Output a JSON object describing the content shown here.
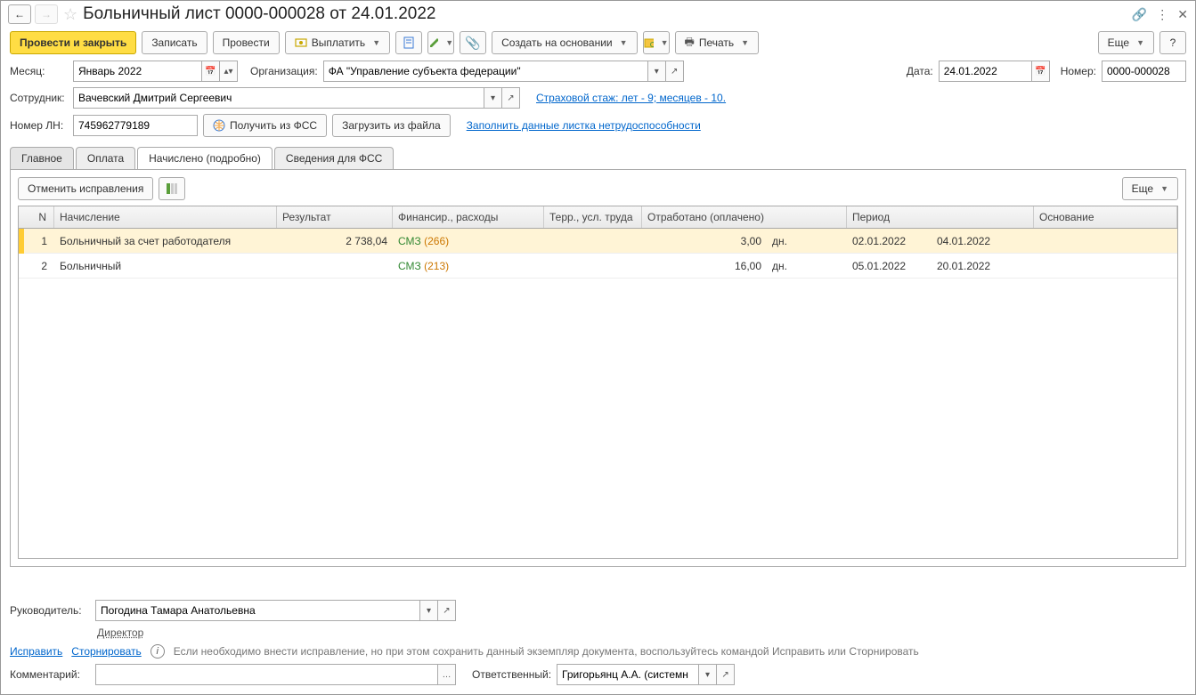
{
  "header": {
    "title": "Больничный лист 0000-000028 от 24.01.2022"
  },
  "toolbar": {
    "post_and_close": "Провести и закрыть",
    "save": "Записать",
    "post": "Провести",
    "pay": "Выплатить",
    "create_based": "Создать на основании",
    "print": "Печать",
    "more": "Еще",
    "help": "?"
  },
  "fields": {
    "month_label": "Месяц:",
    "month_value": "Январь 2022",
    "org_label": "Организация:",
    "org_value": "ФА \"Управление субъекта федерации\"",
    "date_label": "Дата:",
    "date_value": "24.01.2022",
    "number_label": "Номер:",
    "number_value": "0000-000028",
    "employee_label": "Сотрудник:",
    "employee_value": "Вачевский Дмитрий Сергеевич",
    "insurance_link": "Страховой стаж: лет - 9; месяцев - 10.",
    "ln_label": "Номер ЛН:",
    "ln_value": "745962779189",
    "get_from_fss": "Получить из ФСС",
    "load_from_file": "Загрузить из файла",
    "fill_link": "Заполнить данные листка нетрудоспособности"
  },
  "tabs": {
    "main": "Главное",
    "payment": "Оплата",
    "accrued": "Начислено (подробно)",
    "fss": "Сведения для ФСС"
  },
  "inner": {
    "cancel_corrections": "Отменить исправления",
    "more": "Еще"
  },
  "table": {
    "headers": {
      "n": "N",
      "accrual": "Начисление",
      "result": "Результат",
      "finance": "Финансир., расходы",
      "terr": "Терр., усл. труда",
      "worked": "Отработано (оплачено)",
      "period": "Период",
      "basis": "Основание"
    },
    "rows": [
      {
        "n": "1",
        "accrual": "Больничный за счет работодателя",
        "result": "2 738,04",
        "fin_a": "СМЗ",
        "fin_b": "(266)",
        "worked": "3,00",
        "unit": "дн.",
        "p1": "02.01.2022",
        "p2": "04.01.2022"
      },
      {
        "n": "2",
        "accrual": "Больничный",
        "result": "",
        "fin_a": "СМЗ",
        "fin_b": "(213)",
        "worked": "16,00",
        "unit": "дн.",
        "p1": "05.01.2022",
        "p2": "20.01.2022"
      }
    ]
  },
  "footer": {
    "manager_label": "Руководитель:",
    "manager_value": "Погодина Тамара Анатольевна",
    "manager_position": "Директор",
    "fix_link": "Исправить",
    "reverse_link": "Сторнировать",
    "info_text": "Если необходимо внести исправление, но при этом сохранить данный экземпляр документа, воспользуйтесь командой Исправить или Сторнировать",
    "comment_label": "Комментарий:",
    "responsible_label": "Ответственный:",
    "responsible_value": "Григорьянц А.А. (системн"
  }
}
